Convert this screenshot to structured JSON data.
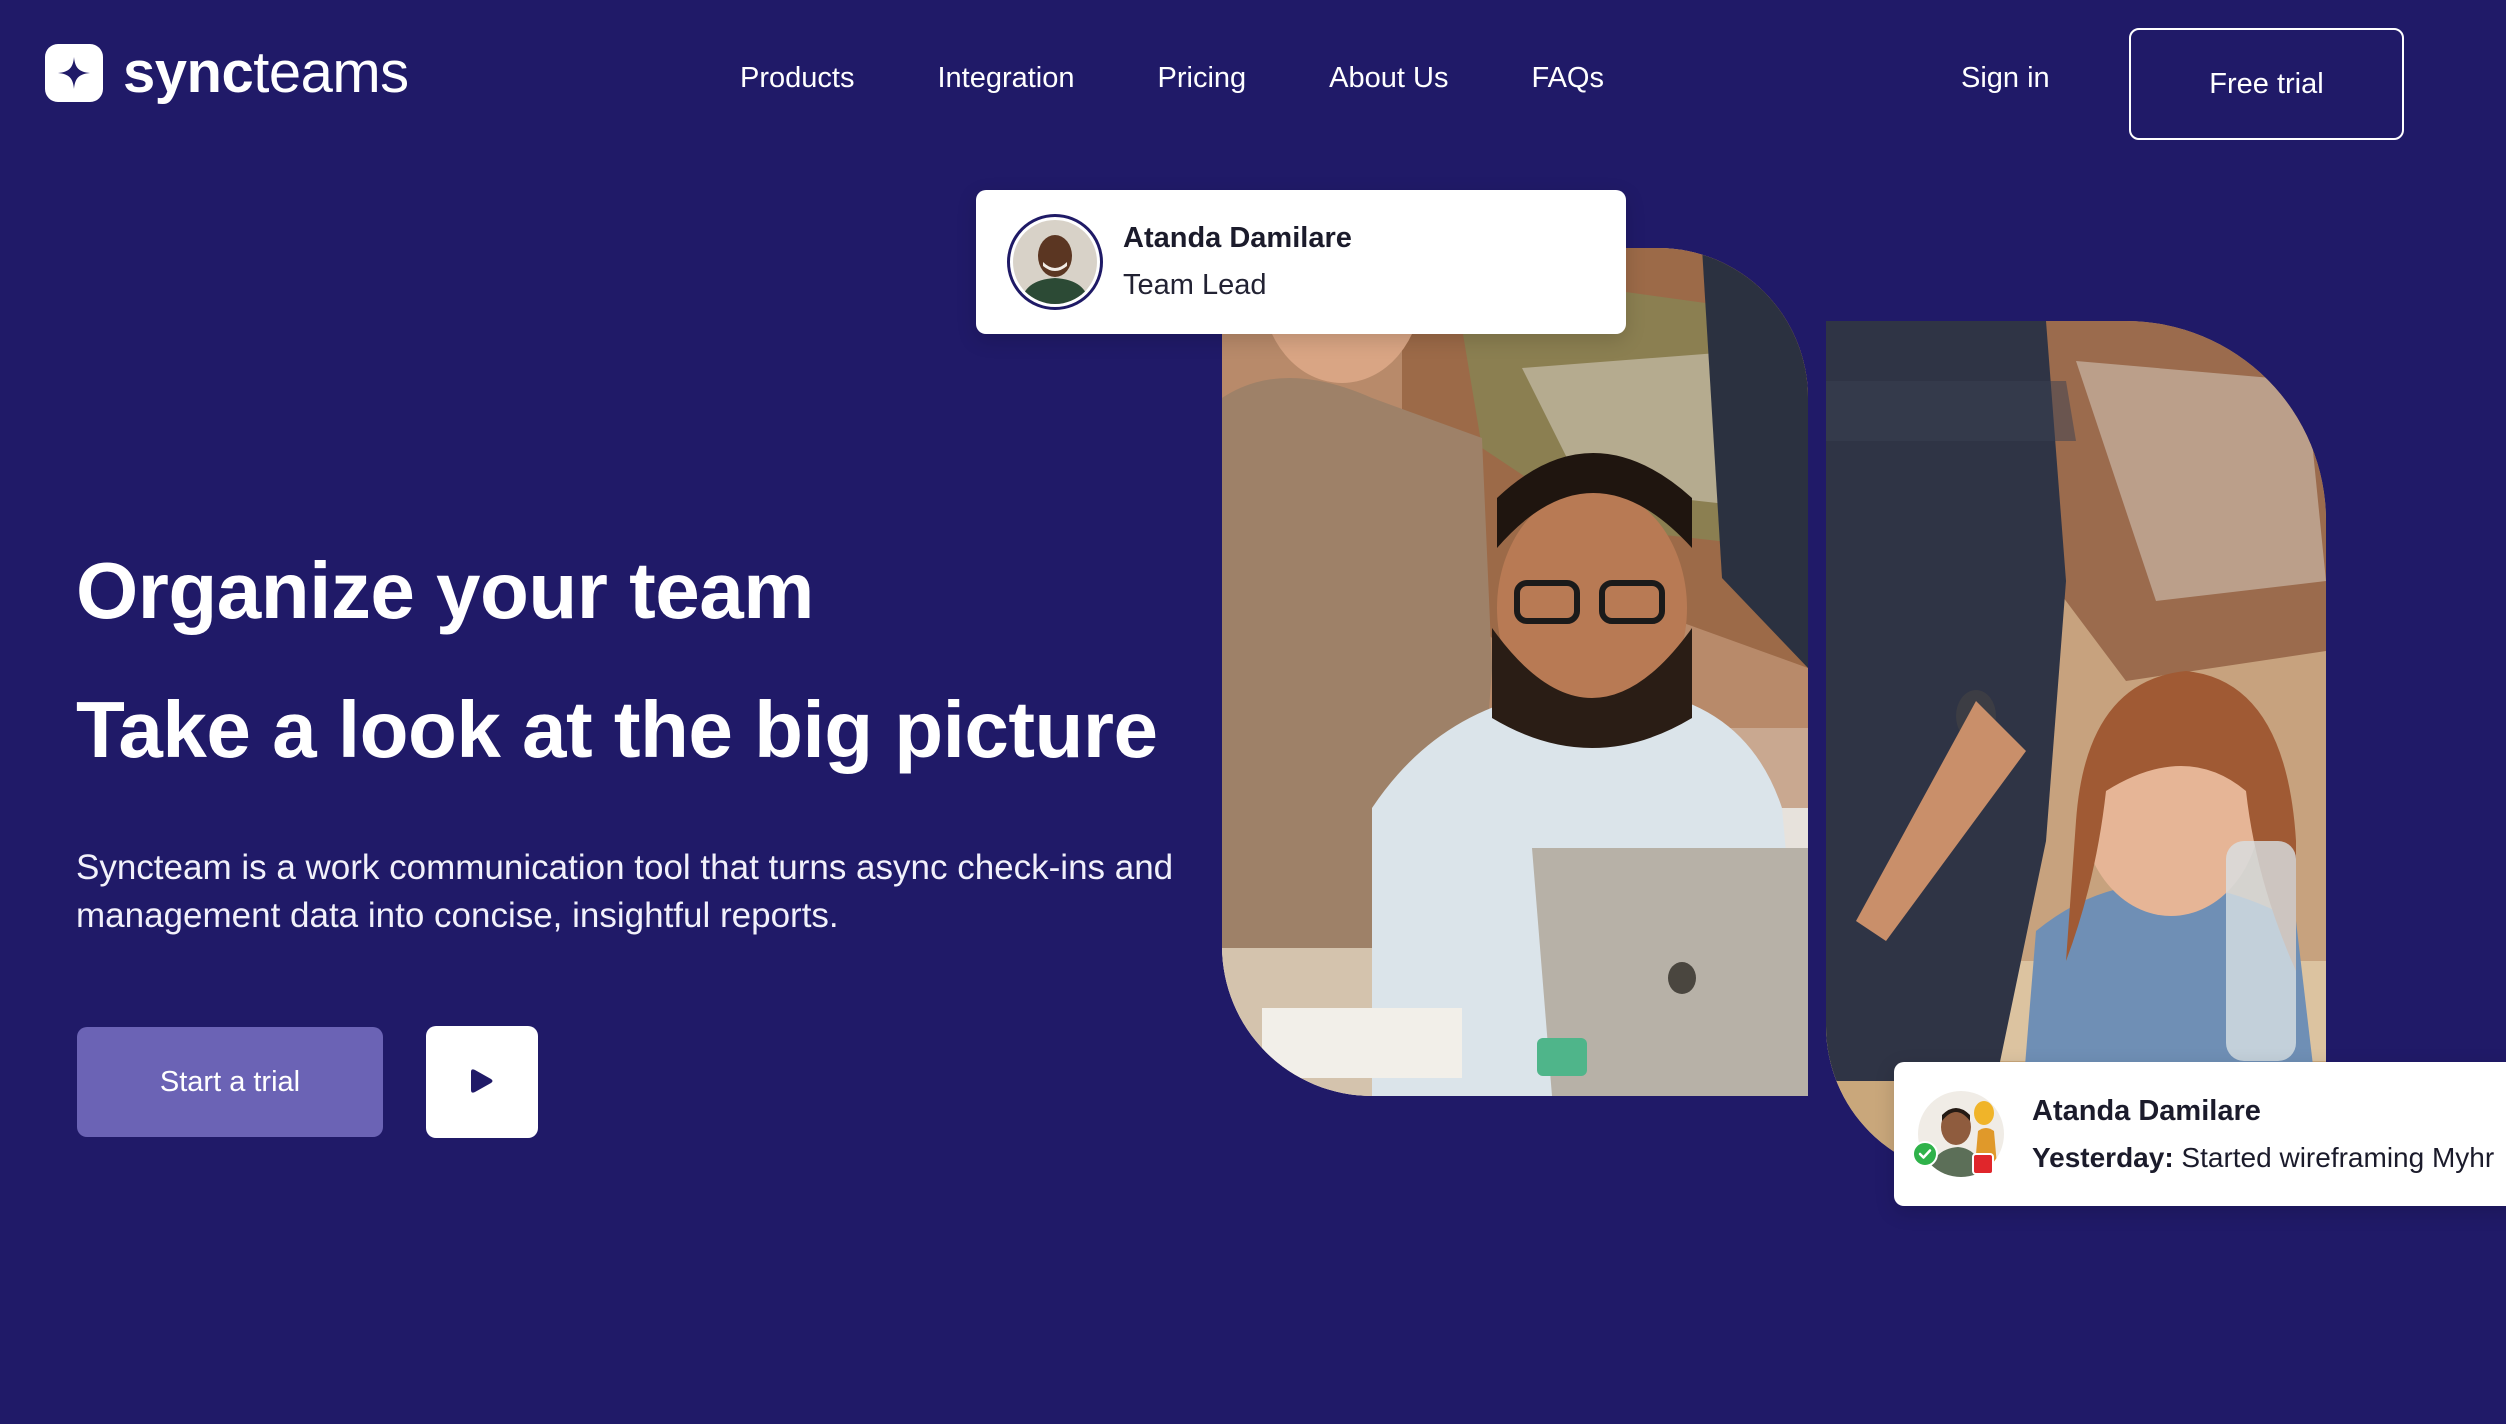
{
  "brand": {
    "name_bold": "sync",
    "name_light": "teams",
    "logo_icon": "sparkle-icon"
  },
  "nav": {
    "items": [
      {
        "label": "Products"
      },
      {
        "label": "Integration"
      },
      {
        "label": "Pricing"
      },
      {
        "label": "About Us"
      },
      {
        "label": "FAQs"
      }
    ],
    "sign_in": "Sign in",
    "free_trial": "Free trial"
  },
  "hero": {
    "headline_1": "Organize your team",
    "headline_2": "Take a look at the big picture",
    "description": "Syncteam is a work communication tool that turns async check-ins and management data into concise, insightful reports.",
    "start_trial": "Start a trial",
    "play_icon": "play-icon"
  },
  "profile_card": {
    "name": "Atanda Damilare",
    "role": "Team Lead"
  },
  "update_card": {
    "name": "Atanda Damilare",
    "update_label": "Yesterday:",
    "update_text": "Started wireframing Myhr"
  },
  "colors": {
    "background": "#201a68",
    "primary_button": "#6b63b5",
    "status_online": "#2fb24a",
    "status_recording": "#e0262b"
  }
}
